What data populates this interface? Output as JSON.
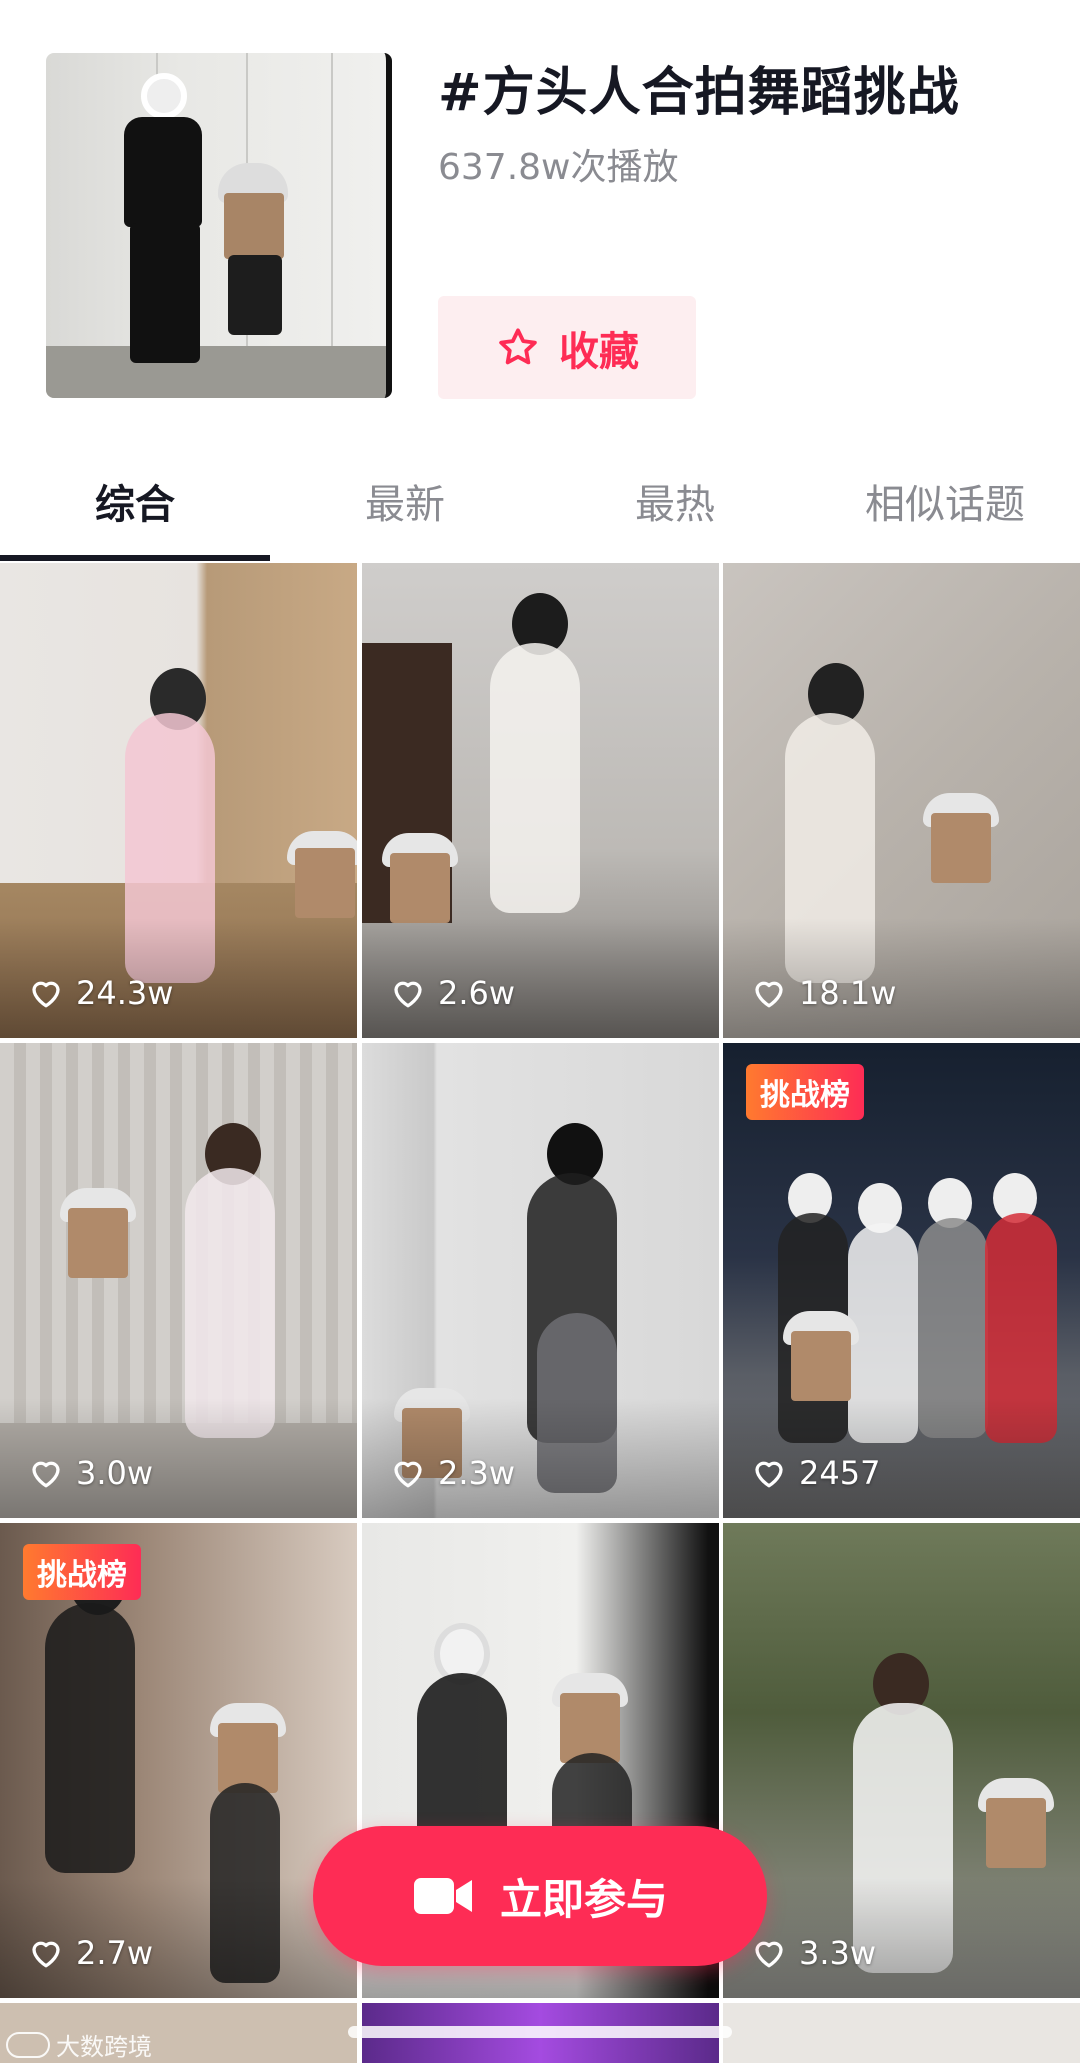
{
  "topic": {
    "title": "#方头人合拍舞蹈挑战",
    "play_count": "637.8w次播放",
    "favorite_label": "收藏"
  },
  "tabs": [
    {
      "label": "综合",
      "active": true
    },
    {
      "label": "最新",
      "active": false
    },
    {
      "label": "最热",
      "active": false
    },
    {
      "label": "相似话题",
      "active": false
    }
  ],
  "videos": [
    {
      "likes": "24.3w",
      "badge": ""
    },
    {
      "likes": "2.6w",
      "badge": ""
    },
    {
      "likes": "18.1w",
      "badge": ""
    },
    {
      "likes": "3.0w",
      "badge": ""
    },
    {
      "likes": "2.3w",
      "badge": ""
    },
    {
      "likes": "2457",
      "badge": "挑战榜"
    },
    {
      "likes": "2.7w",
      "badge": "挑战榜"
    },
    {
      "likes": "",
      "badge": ""
    },
    {
      "likes": "3.3w",
      "badge": ""
    }
  ],
  "join_button": {
    "label": "立即参与"
  },
  "watermark": {
    "text": "大数跨境"
  },
  "colors": {
    "accent": "#fe2c55",
    "badge_start": "#ff7a2f",
    "text_primary": "#161823",
    "text_secondary": "#8a8b91"
  },
  "icons": {
    "favorite": "star-outline-icon",
    "like": "heart-outline-icon",
    "join": "video-camera-icon"
  }
}
